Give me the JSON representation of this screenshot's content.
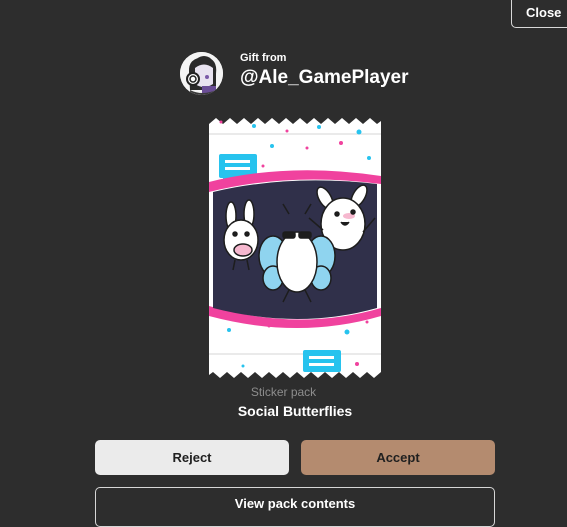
{
  "header": {
    "close_label": "Close"
  },
  "gift": {
    "from_label": "Gift from",
    "sender_name": "@Ale_GamePlayer"
  },
  "pack": {
    "type_label": "Sticker pack",
    "name": "Social Butterflies"
  },
  "actions": {
    "reject_label": "Reject",
    "accept_label": "Accept",
    "view_contents_label": "View pack contents"
  },
  "colors": {
    "background": "#2d2d2d",
    "accept_button": "#b48b6f",
    "reject_button": "#ebebeb",
    "pack_accent_pink": "#f0429e",
    "pack_accent_cyan": "#27c3ee"
  }
}
